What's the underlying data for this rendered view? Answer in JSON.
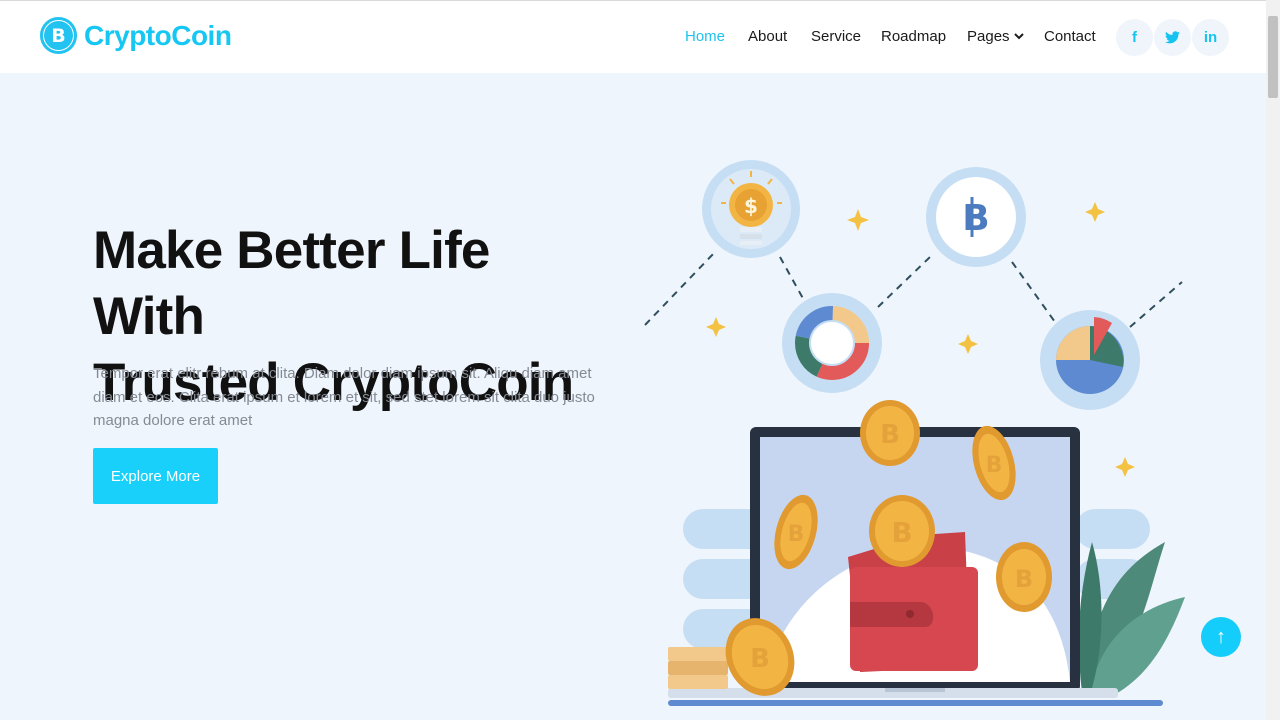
{
  "brand": {
    "name": "CryptoCoin",
    "icon": "bitcoin-icon"
  },
  "nav": {
    "items": [
      {
        "label": "Home",
        "active": true
      },
      {
        "label": "About"
      },
      {
        "label": "Service"
      },
      {
        "label": "Roadmap"
      },
      {
        "label": "Pages",
        "dropdown": true
      },
      {
        "label": "Contact"
      }
    ],
    "dropdown_icon": "chevron-down-icon"
  },
  "social": [
    {
      "icon": "facebook-icon",
      "glyph": "f"
    },
    {
      "icon": "twitter-icon",
      "glyph": "t"
    },
    {
      "icon": "linkedin-icon",
      "glyph": "in"
    }
  ],
  "hero": {
    "title_line1": "Make Better Life With",
    "title_line2": "Trusted CryptoCoin",
    "text": "Tempor erat elitr rebum at clita. Diam dolor diam ipsum sit. Aliqu diam amet diam et eos. Clita erat ipsum et lorem et sit, sed stet lorem sit clita duo justo magna dolore erat amet",
    "button_label": "Explore More"
  },
  "back_to_top": {
    "icon": "arrow-up-icon",
    "glyph": "↑"
  },
  "colors": {
    "accent": "#16c7f3",
    "hero_bg": "#eff5fc",
    "button": "#19d0fb"
  }
}
